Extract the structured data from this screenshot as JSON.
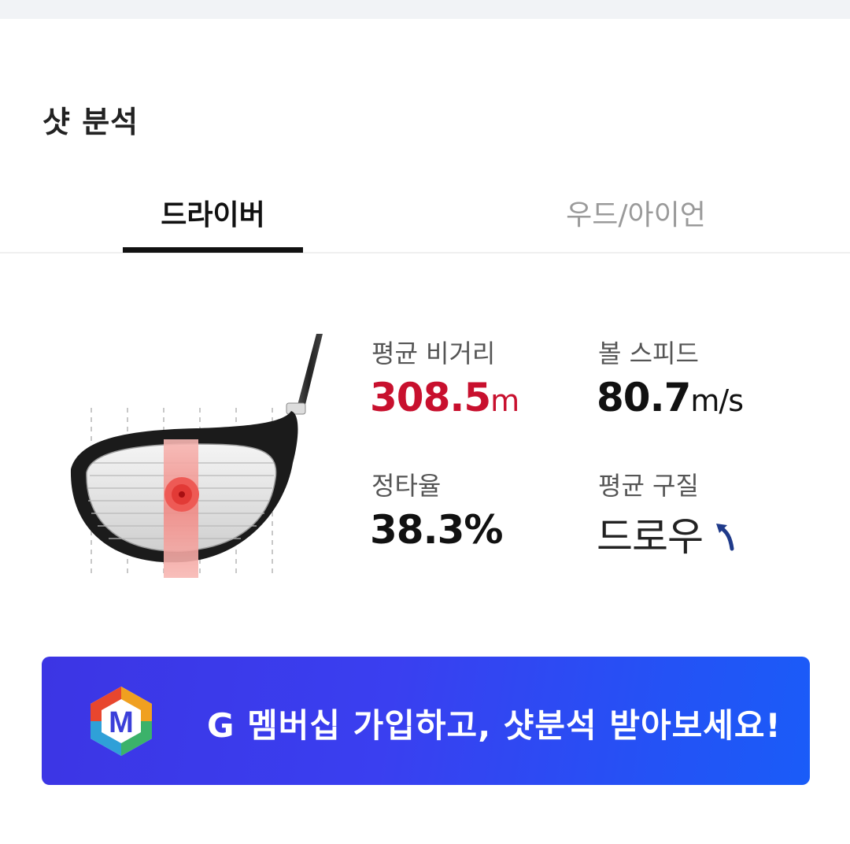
{
  "section": {
    "title": "샷 분석"
  },
  "tabs": [
    {
      "label": "드라이버",
      "active": true
    },
    {
      "label": "우드/아이언",
      "active": false
    }
  ],
  "stats": {
    "avg_distance": {
      "label": "평균 비거리",
      "value": "308.5",
      "unit": "m"
    },
    "ball_speed": {
      "label": "볼 스피드",
      "value": "80.7",
      "unit": "m/s"
    },
    "accuracy": {
      "label": "정타율",
      "value": "38.3%"
    },
    "ball_flight": {
      "label": "평균 구질",
      "value": "드로우",
      "icon": "draw-arrow-icon"
    }
  },
  "banner": {
    "logo_letter": "M",
    "text": "G 멤버십 가입하고, 샷분석 받아보세요!"
  },
  "colors": {
    "accent_red": "#c8102e",
    "banner_blue": "#3a3ff0",
    "arrow_navy": "#1f3a8a"
  }
}
